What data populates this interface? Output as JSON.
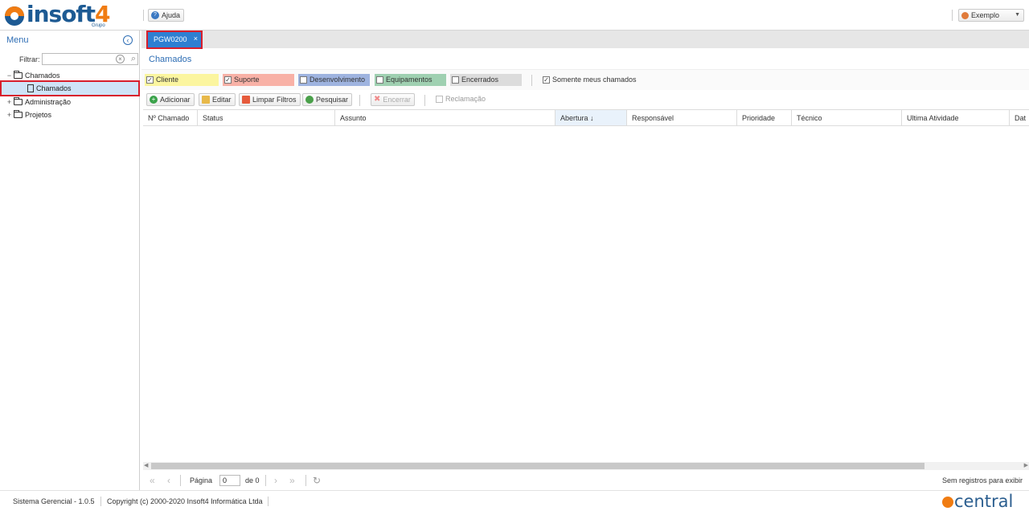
{
  "header": {
    "logo_text": "insoft",
    "logo_digit": "4",
    "logo_sub": "Grupo",
    "help_label": "Ajuda",
    "user_label": "Exemplo"
  },
  "sidebar": {
    "title": "Menu",
    "filter_label": "Filtrar:",
    "filter_value": "",
    "tree": [
      {
        "label": "Chamados",
        "type": "folder",
        "expanded": true
      },
      {
        "label": "Chamados",
        "type": "document",
        "selected": true
      },
      {
        "label": "Administração",
        "type": "folder",
        "expanded": false
      },
      {
        "label": "Projetos",
        "type": "folder",
        "expanded": false
      }
    ]
  },
  "tabs": [
    {
      "label": "PGW0200",
      "close": "×"
    }
  ],
  "page": {
    "title": "Chamados"
  },
  "filters": [
    {
      "label": "Cliente",
      "checked": true,
      "color": "#fbf59f"
    },
    {
      "label": "Suporte",
      "checked": true,
      "color": "#f8b1a6"
    },
    {
      "label": "Desenvolvimento",
      "checked": false,
      "color": "#9eb3df"
    },
    {
      "label": "Equipamentos",
      "checked": false,
      "color": "#9fd0b1"
    },
    {
      "label": "Encerrados",
      "checked": false,
      "color": "#dcdcdc"
    },
    {
      "label": "Somente meus chamados",
      "checked": true,
      "color": "#ffffff"
    }
  ],
  "toolbar": {
    "add_label": "Adicionar",
    "edit_label": "Editar",
    "clear_label": "Limpar Filtros",
    "search_label": "Pesquisar",
    "close_label": "Encerrar",
    "complaint_label": "Reclamação"
  },
  "grid": {
    "columns": [
      "Nº Chamado",
      "Status",
      "Assunto",
      "Abertura ↓",
      "Responsável",
      "Prioridade",
      "Técnico",
      "Ultima Atividade",
      "Dat"
    ],
    "rows": []
  },
  "pager": {
    "page_label": "Página",
    "page_value": "0",
    "of_label": "de 0",
    "empty_text": "Sem registros para exibir"
  },
  "footer": {
    "version": "Sistema Gerencial - 1.0.5",
    "copyright": "Copyright (c) 2000-2020 Insoft4 Informática Ltda",
    "brand": "central"
  }
}
